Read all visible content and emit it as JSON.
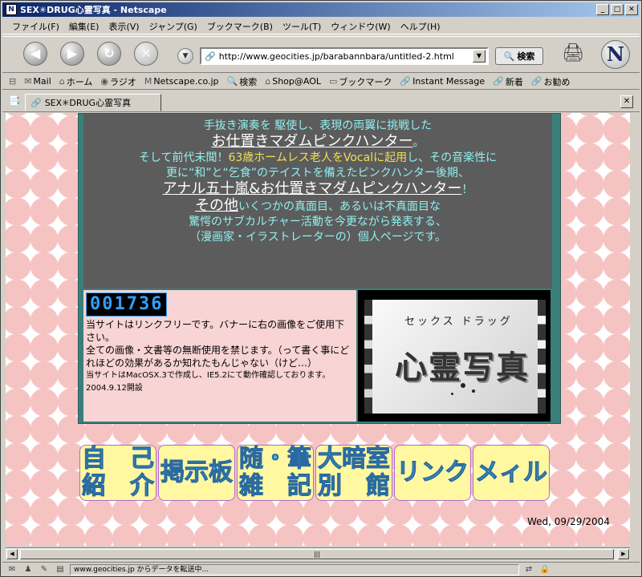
{
  "window": {
    "title": "SEX✳DRUG心霊写真 - Netscape",
    "min": "_",
    "max": "□",
    "close": "✕"
  },
  "menu": [
    "ファイル(F)",
    "編集(E)",
    "表示(V)",
    "ジャンプ(G)",
    "ブックマーク(B)",
    "ツール(T)",
    "ウィンドウ(W)",
    "ヘルプ(H)"
  ],
  "nav": {
    "back": "◀",
    "forward": "▶",
    "reload": "↻",
    "stop": "✕",
    "url": "http://www.geocities.jp/barabannbara/untitled-2.html",
    "search_label": "検索",
    "logo": "N"
  },
  "bookmarks": [
    "Mail",
    "ホーム",
    "ラジオ",
    "Netscape.co.jp",
    "検索",
    "Shop@AOL",
    "ブックマーク",
    "Instant Message",
    "新着",
    "お勧め"
  ],
  "tab": {
    "label": "SEX✳DRUG心霊写真"
  },
  "page": {
    "line1": "手抜き演奏を 駆使し、表現の両翼に挑戦した",
    "line2": "お仕置きマダムピンクハンター",
    "line2_tail": "。",
    "line3_a": "そして前代未聞！",
    "line3_b": "63歳ホームレス老人をVocalに起用",
    "line3_c": "し、その音楽性に",
    "line4": "更に“和”と“乞食”のテイストを備えたピンクハンター後期、",
    "line5": "アナル五十嵐&お仕置きマダムピンクハンター",
    "line5_tail": "！",
    "line6_a": "その他",
    "line6_b": "いくつかの真面目、あるいは不真面目な",
    "line7": "驚愕のサブカルチャー活動を今更ながら発表する、",
    "line8": "（漫画家・イラストレーターの）個人ページです。",
    "counter": "001736",
    "info1": "当サイトはリンクフリーです。バナーに右の画像をご使用下さい。",
    "info2": "全ての画像・文書等の無断使用を禁じます。（って書く事にどれほどの効果があるか知れたもんじゃない（けど…）",
    "info3": "当サイトはMacOSX.3で作成し、IE5.2にて動作確認しております。2004.9.12開設",
    "banner_top": "セックス ドラッグ",
    "banner_main": "心霊写真"
  },
  "navbuttons": [
    "自　己\n紹　介",
    "掲示板",
    "随・筆\n雑　記",
    "大暗室\n別　館",
    "リンク",
    "メィル"
  ],
  "date": "Wed, 09/29/2004",
  "status": {
    "text": "www.geocities.jp からデータを転送中..."
  }
}
